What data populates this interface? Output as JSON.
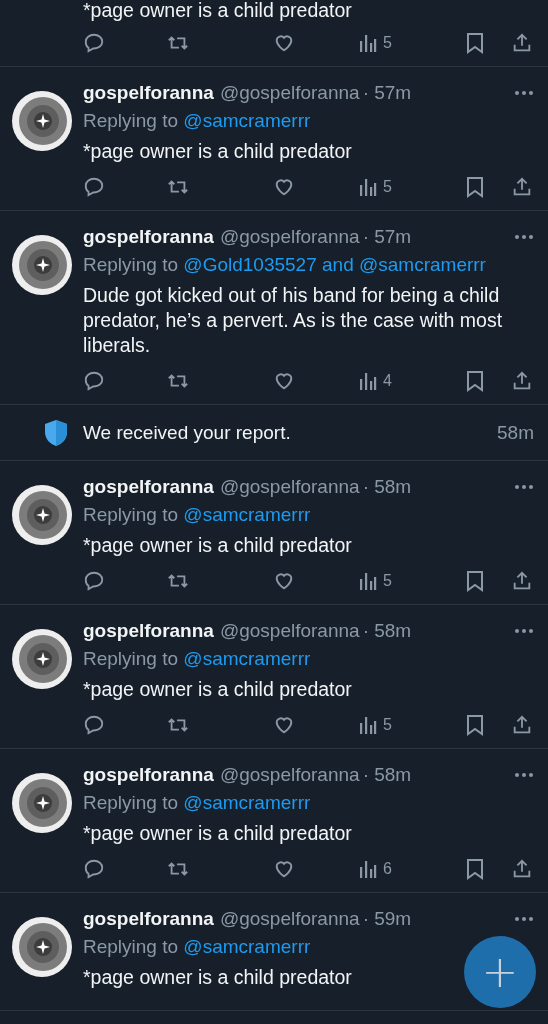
{
  "top_tweet": {
    "body": "*page owner is a child predator",
    "views": "5"
  },
  "timeline": [
    {
      "kind": "tweet",
      "name": "gospelforanna",
      "handle": "@gospelforanna",
      "time": "· 57m",
      "replying_label": "Replying to",
      "reply_to": "@samcramerrr",
      "body": "*page owner is a child predator",
      "views": "5"
    },
    {
      "kind": "tweet",
      "name": "gospelforanna",
      "handle": "@gospelforanna",
      "time": "· 57m",
      "replying_label": "Replying to",
      "reply_to": "@Gold1035527 and @samcramerrr",
      "body": "Dude got kicked out of his band for being a child predator, he’s a pervert. As is the case with most liberals.",
      "views": "4"
    },
    {
      "kind": "notice",
      "text": "We received your report.",
      "time": "58m"
    },
    {
      "kind": "tweet",
      "name": "gospelforanna",
      "handle": "@gospelforanna",
      "time": "· 58m",
      "replying_label": "Replying to",
      "reply_to": "@samcramerrr",
      "body": "*page owner is a child predator",
      "views": "5"
    },
    {
      "kind": "tweet",
      "name": "gospelforanna",
      "handle": "@gospelforanna",
      "time": "· 58m",
      "replying_label": "Replying to",
      "reply_to": "@samcramerrr",
      "body": "*page owner is a child predator",
      "views": "5"
    },
    {
      "kind": "tweet",
      "name": "gospelforanna",
      "handle": "@gospelforanna",
      "time": "· 58m",
      "replying_label": "Replying to",
      "reply_to": "@samcramerrr",
      "body": "*page owner is a child predator",
      "views": "6"
    },
    {
      "kind": "tweet",
      "name": "gospelforanna",
      "handle": "@gospelforanna",
      "time": "· 59m",
      "replying_label": "Replying to",
      "reply_to": "@samcramerrr",
      "body": "*page owner is a child predator"
    }
  ],
  "compose_button": {
    "label": "+"
  }
}
